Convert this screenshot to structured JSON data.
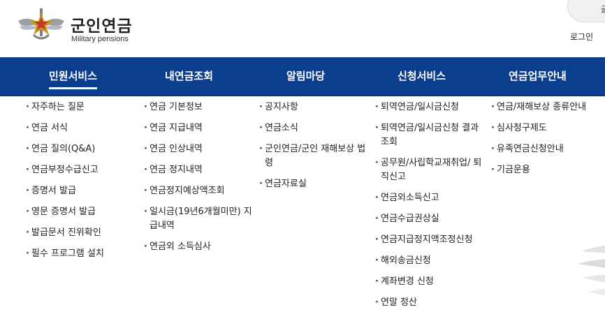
{
  "header": {
    "logo_title": "군인연금",
    "logo_subtitle": "Military pensions",
    "util_label": "글자",
    "login_label": "로그인"
  },
  "colors": {
    "nav_bg": "#0c3e8e",
    "emblem_gold": "#c9971f",
    "emblem_red": "#c0392b"
  },
  "nav": [
    {
      "label": "민원서비스"
    },
    {
      "label": "내연금조회"
    },
    {
      "label": "알림마당"
    },
    {
      "label": "신청서비스"
    },
    {
      "label": "연금업무안내"
    }
  ],
  "menus": [
    {
      "items": [
        "자주하는 질문",
        "연금 서식",
        "연금 질의(Q&A)",
        "연금부정수급신고",
        "증명서 발급",
        "영문 증명서 발급",
        "발급문서 진위확인",
        "필수 프로그램 설치"
      ]
    },
    {
      "items": [
        "연금 기본정보",
        "연금 지급내역",
        "연금 인상내역",
        "연금 정지내역",
        "연금정지예상액조회",
        "일시금(19년6개월미만) 지급내역",
        "연금외 소득심사"
      ]
    },
    {
      "items": [
        "공지사항",
        "연금소식",
        "군인연금/군인 재해보상 법령",
        "연금자료실"
      ]
    },
    {
      "items": [
        "퇴역연금/일시금신청",
        "퇴역연금/일시금신청 결과조회",
        "공무원/사립학교재취업/ 퇴직신고",
        "연금외소득신고",
        "연금수급권상실",
        "연금지급정지액조정신청",
        "해외송금신청",
        "계좌변경 신청",
        "연말 정산"
      ]
    },
    {
      "items": [
        "연금/재해보상 종류안내",
        "심사청구제도",
        "유족연금신청안내",
        "기금운용"
      ]
    }
  ]
}
